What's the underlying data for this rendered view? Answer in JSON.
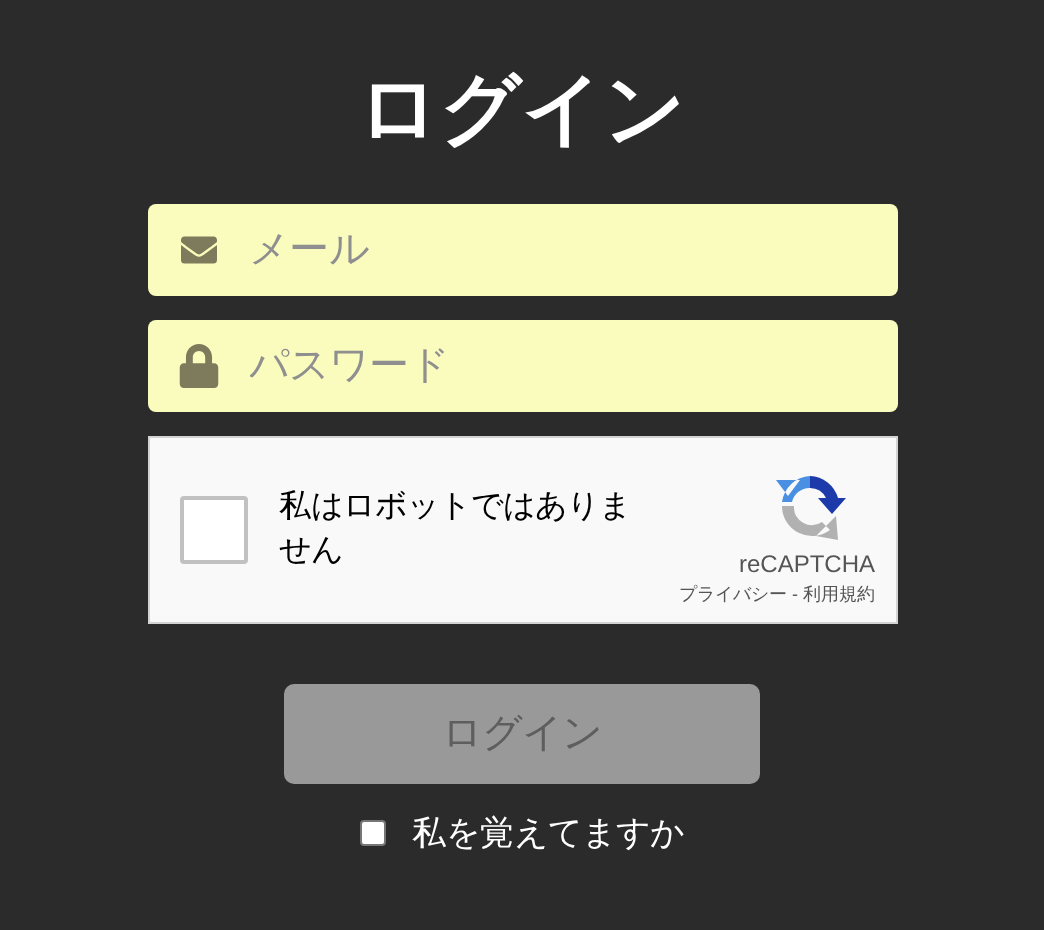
{
  "title": "ログイン",
  "email_field": {
    "placeholder": "メール"
  },
  "password_field": {
    "placeholder": "パスワード"
  },
  "recaptcha": {
    "checked": false,
    "label": "私はロボットではありません",
    "brand": "reCAPTCHA",
    "links": "プライバシー - 利用規約"
  },
  "login_button": {
    "label": "ログイン",
    "disabled": true
  },
  "remember_me": {
    "label": "私を覚えてますか",
    "checked": false
  }
}
